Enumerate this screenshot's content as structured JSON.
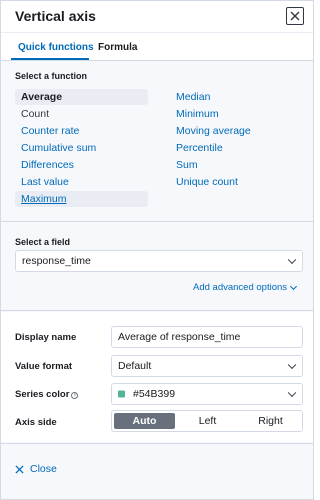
{
  "header": {
    "title": "Vertical axis"
  },
  "tabs": [
    {
      "label": "Quick functions",
      "active": true
    },
    {
      "label": "Formula",
      "active": false
    }
  ],
  "functions": {
    "label": "Select a function",
    "left": [
      "Average",
      "Count",
      "Counter rate",
      "Cumulative sum",
      "Differences",
      "Last value",
      "Maximum"
    ],
    "right": [
      "Median",
      "Minimum",
      "Moving average",
      "Percentile",
      "Sum",
      "Unique count"
    ],
    "selected": "Average",
    "hovered": "Maximum"
  },
  "field": {
    "label": "Select a field",
    "value": "response_time",
    "advanced_link": "Add advanced options"
  },
  "options": {
    "display_name": {
      "label": "Display name",
      "value": "Average of response_time"
    },
    "value_format": {
      "label": "Value format",
      "value": "Default"
    },
    "series_color": {
      "label": "Series color",
      "value": "#54B399",
      "swatch_color": "#54B399"
    },
    "axis_side": {
      "label": "Axis side",
      "options": [
        "Auto",
        "Left",
        "Right"
      ],
      "selected": "Auto"
    }
  },
  "footer": {
    "close_label": "Close"
  },
  "colors": {
    "accent": "#006bb8",
    "text": "#1a1c21",
    "border": "#d3dae6"
  }
}
